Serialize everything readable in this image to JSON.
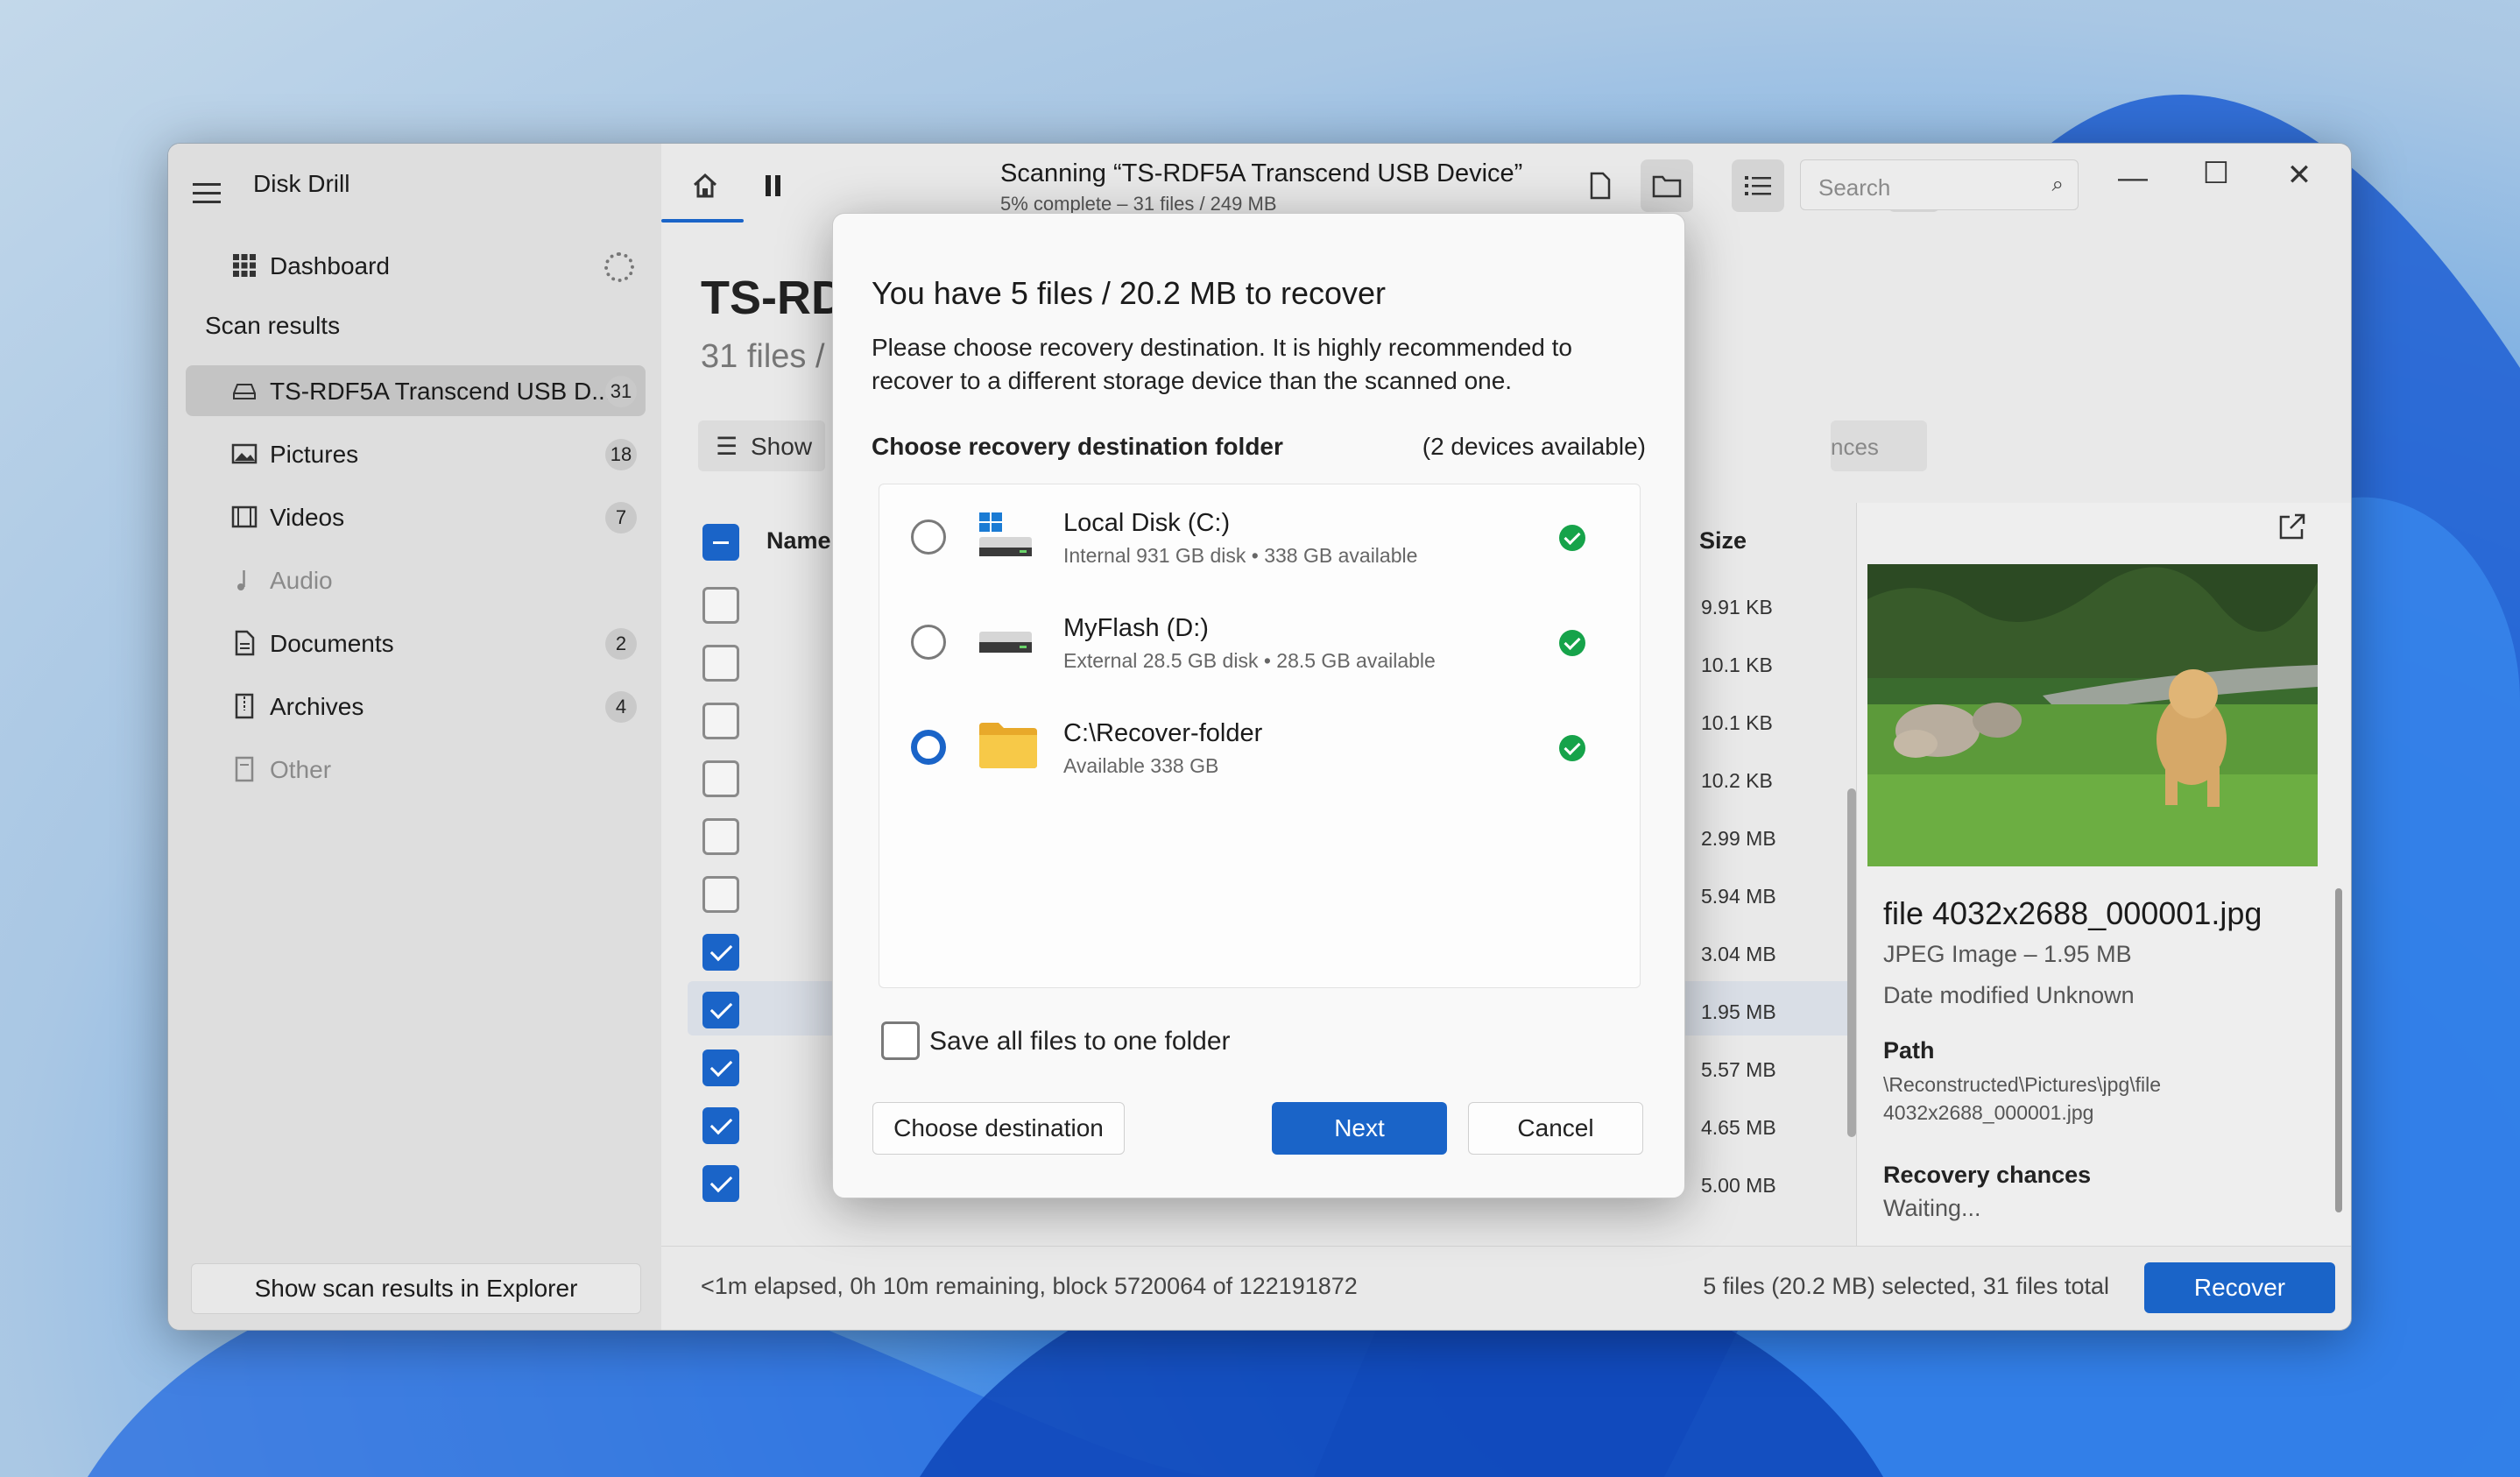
{
  "app": {
    "title": "Disk Drill"
  },
  "sidebar": {
    "dashboard": "Dashboard",
    "section": "Scan results",
    "items": [
      {
        "label": "TS-RDF5A Transcend USB D...",
        "count": "31",
        "icon": "drive-icon"
      },
      {
        "label": "Pictures",
        "count": "18",
        "icon": "picture-icon"
      },
      {
        "label": "Videos",
        "count": "7",
        "icon": "film-icon"
      },
      {
        "label": "Audio",
        "count": "",
        "icon": "music-note-icon"
      },
      {
        "label": "Documents",
        "count": "2",
        "icon": "document-icon"
      },
      {
        "label": "Archives",
        "count": "4",
        "icon": "archive-icon"
      },
      {
        "label": "Other",
        "count": "",
        "icon": "file-icon"
      }
    ],
    "explorer_button": "Show scan results in Explorer"
  },
  "toolbar": {
    "scan_title": "Scanning “TS-RDF5A Transcend USB Device”",
    "scan_sub": "5% complete – 31 files / 249 MB",
    "search_placeholder": "Search"
  },
  "main": {
    "title": "TS-RD",
    "subtitle": "31 files /",
    "show_button": "Show",
    "chances_fragment": "nces",
    "col_name": "Name",
    "col_size": "Size",
    "rows": [
      {
        "size": "9.91 KB",
        "checked": false
      },
      {
        "size": "10.1 KB",
        "checked": false
      },
      {
        "size": "10.1 KB",
        "checked": false
      },
      {
        "size": "10.2 KB",
        "checked": false
      },
      {
        "size": "2.99 MB",
        "checked": false
      },
      {
        "size": "5.94 MB",
        "checked": false
      },
      {
        "size": "3.04 MB",
        "checked": true
      },
      {
        "size": "1.95 MB",
        "checked": true
      },
      {
        "size": "5.57 MB",
        "checked": true
      },
      {
        "size": "4.65 MB",
        "checked": true
      },
      {
        "size": "5.00 MB",
        "checked": true
      }
    ]
  },
  "preview": {
    "name": "file 4032x2688_000001.jpg",
    "type": "JPEG Image – 1.95 MB",
    "modified": "Date modified Unknown",
    "path_label": "Path",
    "path_line1": "\\Reconstructed\\Pictures\\jpg\\file",
    "path_line2": "4032x2688_000001.jpg",
    "chances_label": "Recovery chances",
    "chances_value": "Waiting..."
  },
  "status": {
    "left": "<1m elapsed, 0h 10m remaining, block 5720064 of 122191872",
    "right": "5 files (20.2 MB) selected, 31 files total",
    "recover_button": "Recover"
  },
  "dialog": {
    "title": "You have 5 files / 20.2 MB to recover",
    "desc": "Please choose recovery destination. It is highly recommended to recover to a different storage device than the scanned one.",
    "folder_label": "Choose recovery destination folder",
    "devices": "(2 devices available)",
    "options": [
      {
        "name": "Local Disk (C:)",
        "info": "Internal 931 GB disk • 338 GB available",
        "selected": false
      },
      {
        "name": "MyFlash (D:)",
        "info": "External 28.5 GB disk • 28.5 GB available",
        "selected": false
      },
      {
        "name": "C:\\Recover-folder",
        "info": "Available 338 GB",
        "selected": true
      }
    ],
    "save_one_folder": "Save all files to one folder",
    "choose_button": "Choose destination",
    "next_button": "Next",
    "cancel_button": "Cancel"
  },
  "colors": {
    "accent": "#1a64c8",
    "ok": "#16a34a"
  }
}
